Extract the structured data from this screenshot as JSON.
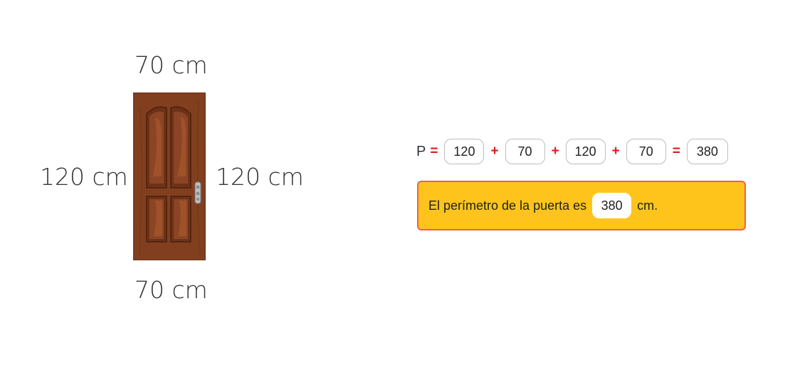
{
  "door": {
    "top_label": "70 cm",
    "bottom_label": "70 cm",
    "left_label": "120 cm",
    "right_label": "120 cm"
  },
  "equation": {
    "variable": "P",
    "equals": "=",
    "plus": "+",
    "terms": [
      "120",
      "70",
      "120",
      "70"
    ],
    "result": "380"
  },
  "answer": {
    "prefix": "El perímetro de la puerta es",
    "value": "380",
    "suffix": "cm."
  },
  "colors": {
    "operator": "#e0181b",
    "banner_fill": "#ffc41c",
    "banner_border": "#f0604c",
    "door_wood": "#7a3a1c"
  }
}
